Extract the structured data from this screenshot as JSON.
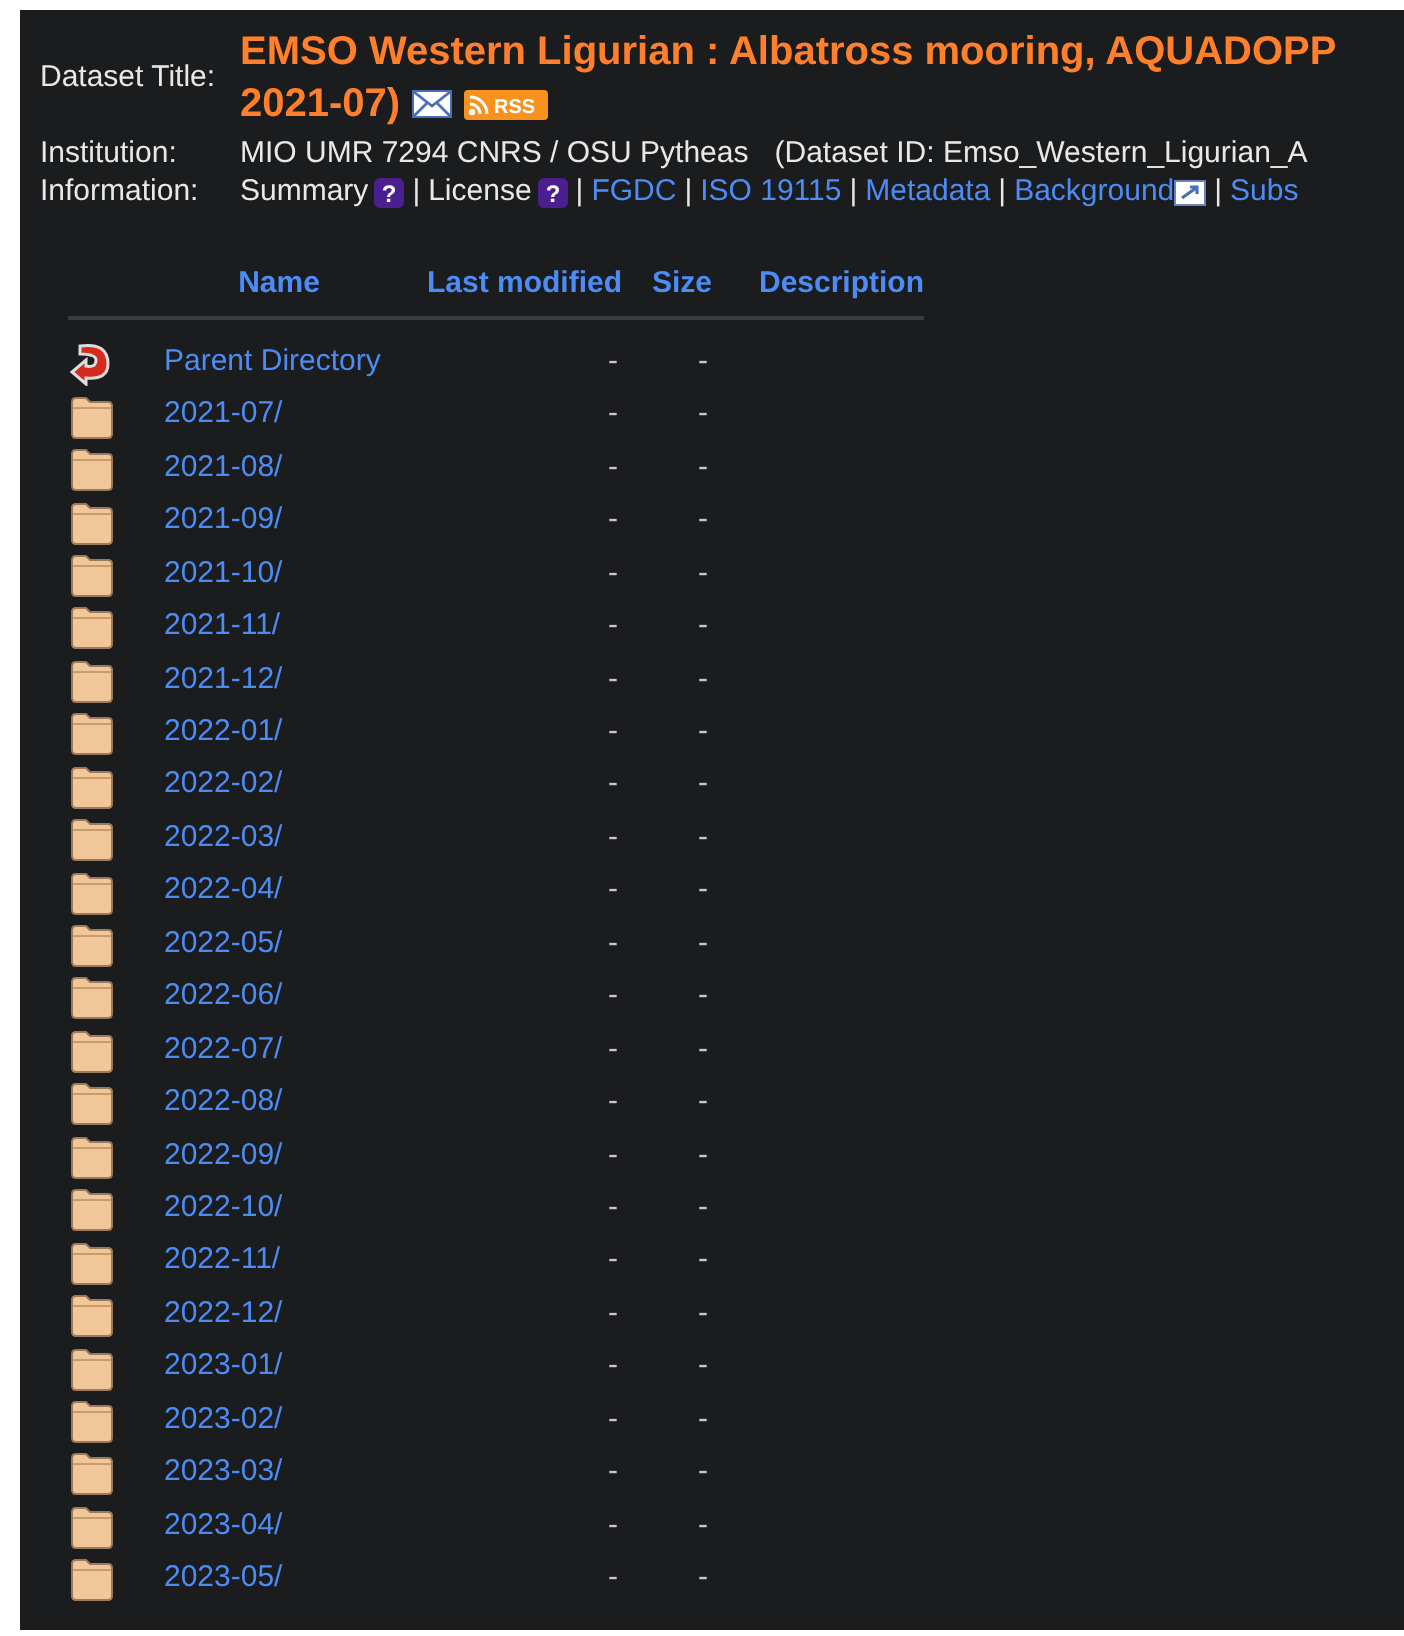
{
  "header": {
    "title_label": "Dataset Title:",
    "title_lines": [
      "EMSO Western Ligurian : Albatross mooring, AQUADOPP",
      "2021-07)"
    ],
    "rss_label": "RSS",
    "institution_label": "Institution:",
    "institution": "MIO UMR 7294 CNRS / OSU Pytheas",
    "dataset_id": "(Dataset ID: Emso_Western_Ligurian_A",
    "information_label": "Information:",
    "information": [
      {
        "kind": "help",
        "text": "Summary",
        "icon_text": "?"
      },
      {
        "kind": "separator",
        "text": "|"
      },
      {
        "kind": "help",
        "text": "License",
        "icon_text": "?"
      },
      {
        "kind": "separator",
        "text": "|"
      },
      {
        "kind": "link",
        "text": "FGDC"
      },
      {
        "kind": "separator",
        "text": "|"
      },
      {
        "kind": "link",
        "text": "ISO 19115"
      },
      {
        "kind": "separator",
        "text": "|"
      },
      {
        "kind": "link",
        "text": "Metadata"
      },
      {
        "kind": "separator",
        "text": "|"
      },
      {
        "kind": "external",
        "text": "Background"
      },
      {
        "kind": "separator",
        "text": "|"
      },
      {
        "kind": "link",
        "text": "Subs"
      }
    ]
  },
  "table": {
    "columns": [
      "Name",
      "Last modified",
      "Size",
      "Description"
    ],
    "rows": [
      {
        "kind": "parent",
        "name": "Parent Directory",
        "last_modified": "-",
        "size": "-"
      },
      {
        "kind": "folder",
        "name": "2021-07/",
        "last_modified": "-",
        "size": "-"
      },
      {
        "kind": "folder",
        "name": "2021-08/",
        "last_modified": "-",
        "size": "-"
      },
      {
        "kind": "folder",
        "name": "2021-09/",
        "last_modified": "-",
        "size": "-"
      },
      {
        "kind": "folder",
        "name": "2021-10/",
        "last_modified": "-",
        "size": "-"
      },
      {
        "kind": "folder",
        "name": "2021-11/",
        "last_modified": "-",
        "size": "-"
      },
      {
        "kind": "folder",
        "name": "2021-12/",
        "last_modified": "-",
        "size": "-"
      },
      {
        "kind": "folder",
        "name": "2022-01/",
        "last_modified": "-",
        "size": "-"
      },
      {
        "kind": "folder",
        "name": "2022-02/",
        "last_modified": "-",
        "size": "-"
      },
      {
        "kind": "folder",
        "name": "2022-03/",
        "last_modified": "-",
        "size": "-"
      },
      {
        "kind": "folder",
        "name": "2022-04/",
        "last_modified": "-",
        "size": "-"
      },
      {
        "kind": "folder",
        "name": "2022-05/",
        "last_modified": "-",
        "size": "-"
      },
      {
        "kind": "folder",
        "name": "2022-06/",
        "last_modified": "-",
        "size": "-"
      },
      {
        "kind": "folder",
        "name": "2022-07/",
        "last_modified": "-",
        "size": "-"
      },
      {
        "kind": "folder",
        "name": "2022-08/",
        "last_modified": "-",
        "size": "-"
      },
      {
        "kind": "folder",
        "name": "2022-09/",
        "last_modified": "-",
        "size": "-"
      },
      {
        "kind": "folder",
        "name": "2022-10/",
        "last_modified": "-",
        "size": "-"
      },
      {
        "kind": "folder",
        "name": "2022-11/",
        "last_modified": "-",
        "size": "-"
      },
      {
        "kind": "folder",
        "name": "2022-12/",
        "last_modified": "-",
        "size": "-"
      },
      {
        "kind": "folder",
        "name": "2023-01/",
        "last_modified": "-",
        "size": "-"
      },
      {
        "kind": "folder",
        "name": "2023-02/",
        "last_modified": "-",
        "size": "-"
      },
      {
        "kind": "folder",
        "name": "2023-03/",
        "last_modified": "-",
        "size": "-"
      },
      {
        "kind": "folder",
        "name": "2023-04/",
        "last_modified": "-",
        "size": "-"
      },
      {
        "kind": "folder",
        "name": "2023-05/",
        "last_modified": "-",
        "size": "-"
      }
    ]
  }
}
